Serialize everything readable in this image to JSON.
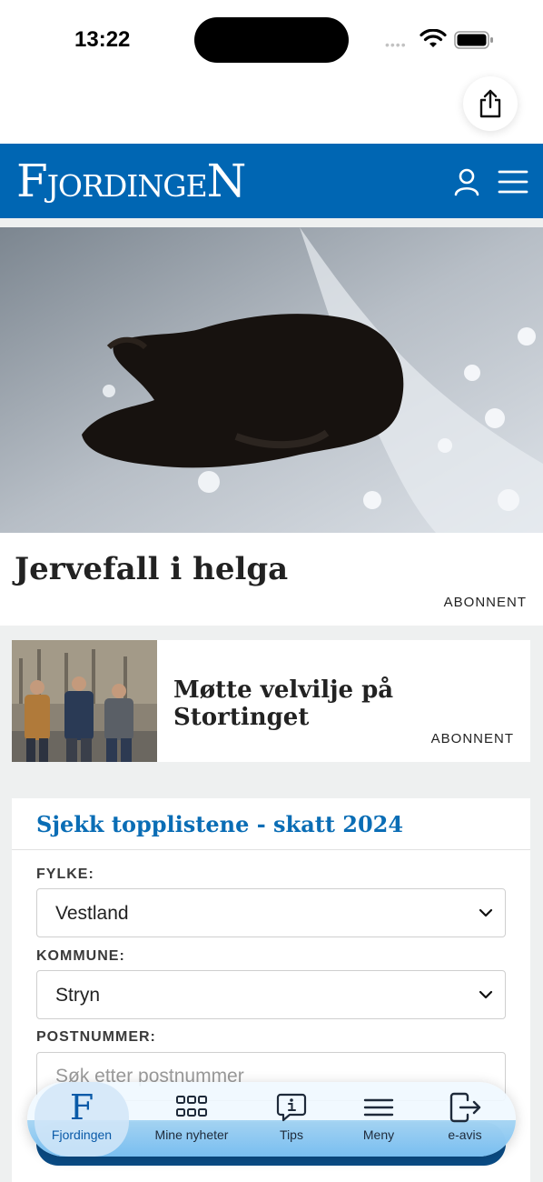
{
  "status_bar": {
    "time": "13:22",
    "signal_dots": "••••",
    "icons": [
      "wifi-icon",
      "battery-icon"
    ]
  },
  "toolbar": {
    "share_icon": "share-icon"
  },
  "header": {
    "logo_first": "F",
    "logo_middle": "JORDINGE",
    "logo_last": "N",
    "brand_color": "#0066b3",
    "icons": [
      "user-icon",
      "hamburger-menu-icon"
    ]
  },
  "hero": {
    "title": "Jervefall i helga",
    "badge": "ABONNENT"
  },
  "article": {
    "title": "Møtte velvilje på Stortinget",
    "badge": "ABONNENT"
  },
  "tax": {
    "title": "Sjekk topplistene - skatt 2024",
    "county_label": "FYLKE:",
    "county_value": "Vestland",
    "municipality_label": "KOMMUNE:",
    "municipality_value": "Stryn",
    "postal_label": "POSTNUMMER:",
    "postal_placeholder": "Søk etter postnummer"
  },
  "tabbar": {
    "tabs": [
      {
        "label": "Fjordingen",
        "icon": "fjordingen-logo-icon",
        "active": true
      },
      {
        "label": "Mine nyheter",
        "icon": "grid-icon",
        "active": false
      },
      {
        "label": "Tips",
        "icon": "info-bubble-icon",
        "active": false
      },
      {
        "label": "Meny",
        "icon": "menu-lines-icon",
        "active": false
      },
      {
        "label": "e-avis",
        "icon": "exit-door-icon",
        "active": false
      }
    ]
  }
}
